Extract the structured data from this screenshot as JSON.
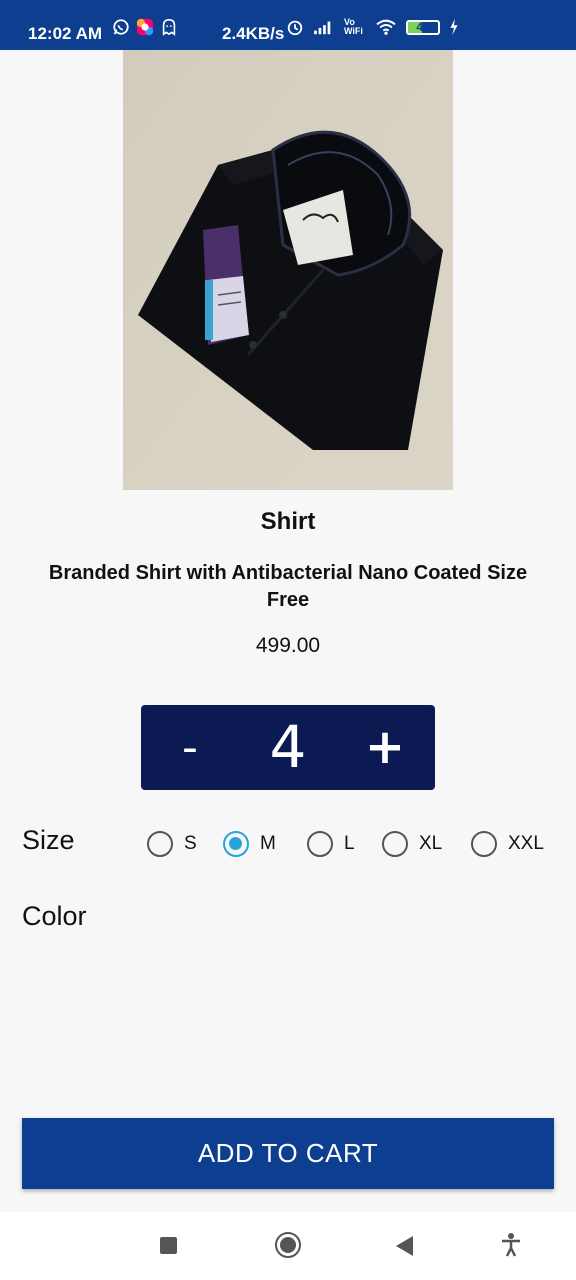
{
  "status_bar": {
    "time": "12:02 AM",
    "network_speed": "2.4KB/s",
    "network_type": "Vo WiFi",
    "battery_level": "47",
    "icons": [
      "whatsapp-icon",
      "app-icon",
      "ghost-icon",
      "alarm-icon",
      "signal-icon",
      "vowifi-icon",
      "wifi-icon",
      "battery-icon",
      "charging-icon"
    ]
  },
  "product": {
    "image_icon": "shirt-photo",
    "name": "Shirt",
    "description": "Branded Shirt with Antibacterial Nano Coated Size Free",
    "price": "499.00"
  },
  "quantity": {
    "minus_label": "-",
    "value": "4",
    "plus_label": "+"
  },
  "size": {
    "label": "Size",
    "options": [
      "S",
      "M",
      "L",
      "XL",
      "XXL"
    ],
    "selected": "M"
  },
  "color": {
    "label": "Color"
  },
  "actions": {
    "add_to_cart_label": "ADD TO CART"
  },
  "colors": {
    "primary": "#0d3e8f",
    "qty_background": "#0b1a52",
    "radio_accent": "#2aa3dd",
    "background": "#f7f7f7"
  },
  "nav_bar": {
    "icons": [
      "recents-icon",
      "home-icon",
      "back-icon",
      "accessibility-icon"
    ]
  }
}
